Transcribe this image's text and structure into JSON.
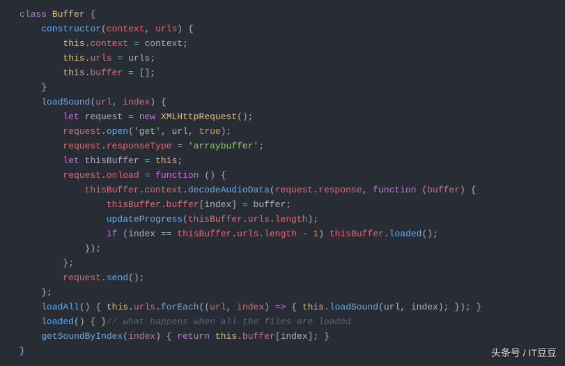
{
  "code": {
    "t": {
      "class": "class",
      "let": "let",
      "new": "new",
      "function": "function",
      "return": "return",
      "if": "if",
      "true": "true",
      "this": "this",
      "Buffer": "Buffer",
      "XMLHttpRequest": "XMLHttpRequest",
      "constructor": "constructor",
      "context": "context",
      "urls": "urls",
      "url": "url",
      "index": "index",
      "buffer": "buffer",
      "request": "request",
      "thisBuffer": "thisBuffer",
      "loadSound": "loadSound",
      "loadAll": "loadAll",
      "loaded": "loaded",
      "getSoundByIndex": "getSoundByIndex",
      "open": "open",
      "responseType": "responseType",
      "onload": "onload",
      "decodeAudioData": "decodeAudioData",
      "response": "response",
      "updateProgress": "updateProgress",
      "length": "length",
      "send": "send",
      "forEach": "forEach",
      "arrow": "=>",
      "eq": "=",
      "eqeq": "==",
      "minus": "-",
      "one": "1",
      "emptyArr": "[]",
      "str_get": "'get'",
      "str_arraybuffer": "'arraybuffer'",
      "comment_loaded": "// what happens when all the files are loaded"
    }
  },
  "watermark": "头条号 / IT豆豆"
}
